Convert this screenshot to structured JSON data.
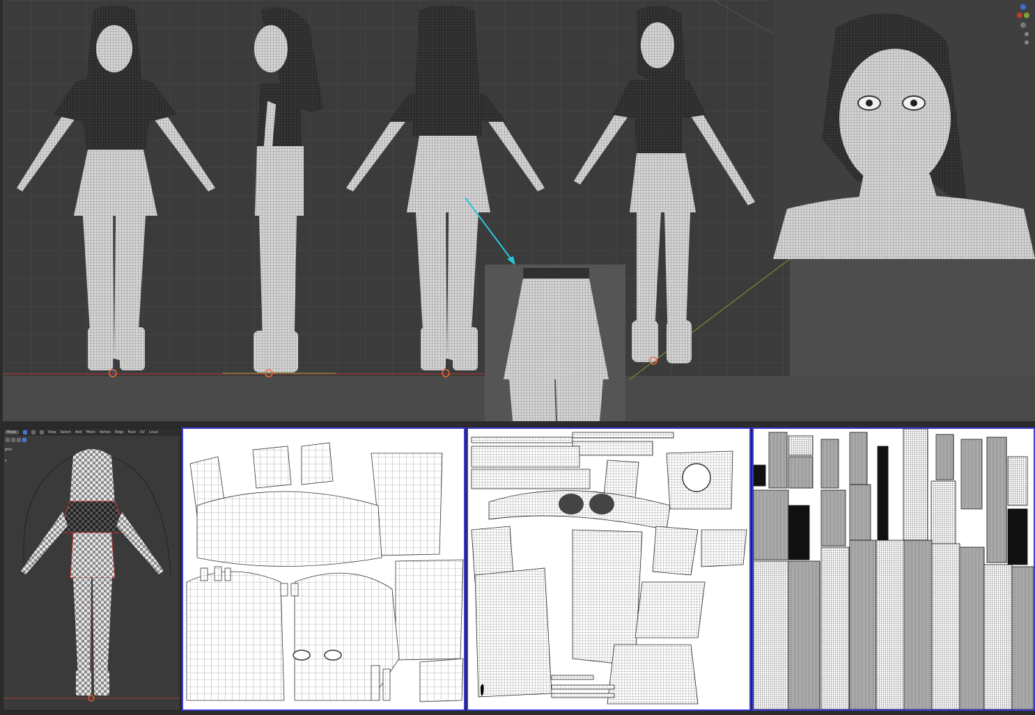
{
  "blender_header": {
    "mode": "Mode",
    "menus": [
      "View",
      "Select",
      "Add",
      "Mesh",
      "Vertex",
      "Edge",
      "Face",
      "UV"
    ],
    "transform_space": "Local"
  },
  "blender_side_labels": [
    "phic",
    "s"
  ],
  "colors": {
    "viewport_bg": "#3b3b3b",
    "grid_line": "#444444",
    "x_axis": "#c0392b",
    "y_axis": "#7aa33a",
    "z_axis": "#3d6fd1",
    "arrow": "#27c7d9",
    "uv_border": "#3b3bd6"
  },
  "icons": [
    "viewport-gizmo-icon",
    "callout-arrow-icon",
    "origin-marker-icon"
  ]
}
